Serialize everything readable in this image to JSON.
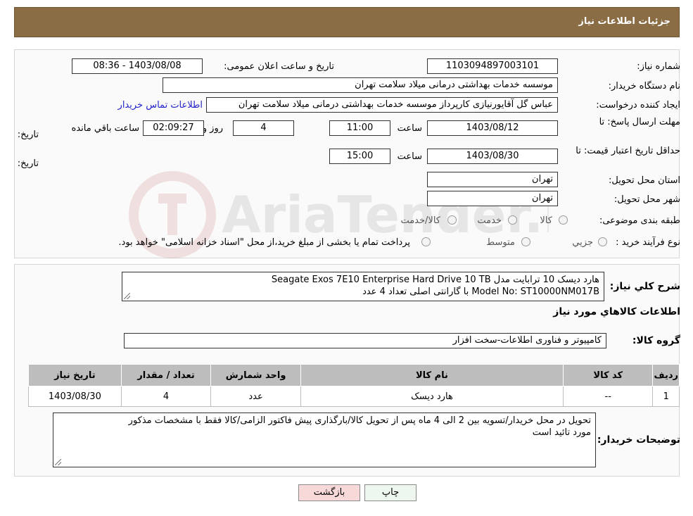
{
  "header": {
    "title": "جزئیات اطلاعات نیاز"
  },
  "form": {
    "need_number_label": "شماره نیاز:",
    "need_number": "1103094897003101",
    "announce_label": "تاریخ و ساعت اعلان عمومی:",
    "announce_value": "1403/08/08 - 08:36",
    "buyer_org_label": "نام دستگاه خریدار:",
    "buyer_org": "موسسه خدمات بهداشتی درمانی میلاد سلامت تهران",
    "creator_label": "ایجاد کننده درخواست:",
    "creator": "عباس گل آقایورنیازی کارپرداز موسسه خدمات بهداشتی درمانی میلاد سلامت تهران",
    "contact_link": "اطلاعات تماس خریدار",
    "deadline_label_1": "مهلت ارسال پاسخ: تا",
    "deadline_label_2": "تاریخ:",
    "deadline_date": "1403/08/12",
    "time_label": "ساعت",
    "deadline_time": "11:00",
    "days_value": "4",
    "days_label": "روز و",
    "remaining_time": "02:09:27",
    "remaining_label": "ساعت باقي مانده",
    "validity_label_1": "حداقل تاریخ اعتبار قیمت: تا",
    "validity_label_2": "تاریخ:",
    "validity_date": "1403/08/30",
    "validity_time": "15:00",
    "province_label": "استان محل تحویل:",
    "province": "تهران",
    "city_label": "شهر محل تحویل:",
    "city": "تهران",
    "category_label": "طبقه بندی موضوعی:",
    "category_options": [
      "کالا",
      "خدمت",
      "کالا/خدمت"
    ],
    "process_label": "نوع فرآیند خرید :",
    "process_options": [
      "جزیي",
      "متوسط"
    ],
    "process_note": "پرداخت تمام یا بخشی از مبلغ خرید،از محل \"اسناد خزانه اسلامی\" خواهد بود."
  },
  "description": {
    "label": "شرح کلي نياز:",
    "line1": "هارد دیسک 10 ترابایت مدل Seagate  Exos 7E10 Enterprise Hard Drive 10 TB",
    "line2": "Model No: ST10000NM017B  با گارانتی اصلی تعداد 4 عدد"
  },
  "goods": {
    "section_title": "اطلاعات کالاهاي مورد نياز",
    "group_label": "گروه کالا:",
    "group_value": "کامپیوتر و فناوری اطلاعات-سخت افزار",
    "columns": [
      "رديف",
      "کد کالا",
      "نام کالا",
      "واحد شمارش",
      "تعداد / مقدار",
      "تاریخ نیاز"
    ],
    "rows": [
      {
        "index": "1",
        "code": "--",
        "name": "هارد دیسک",
        "unit": "عدد",
        "qty": "4",
        "date": "1403/08/30"
      }
    ]
  },
  "buyer_notes": {
    "label": "توضیحات خریدار:",
    "line1": "تحویل در محل خریدار/تسویه بین 2 الی 4 ماه پس از تحویل کالا/بارگذاری پیش فاکتور الزامی/کالا فقط با مشخصات مذکور",
    "line2": "مورد تائید است"
  },
  "buttons": {
    "print": "چاپ",
    "back": "بازگشت"
  },
  "watermark": {
    "text": "AriaTender.neT"
  },
  "colors": {
    "header_bg": "#8b6d45",
    "back_button_bg": "#f7d9d9",
    "print_button_bg": "#eef7ee"
  }
}
